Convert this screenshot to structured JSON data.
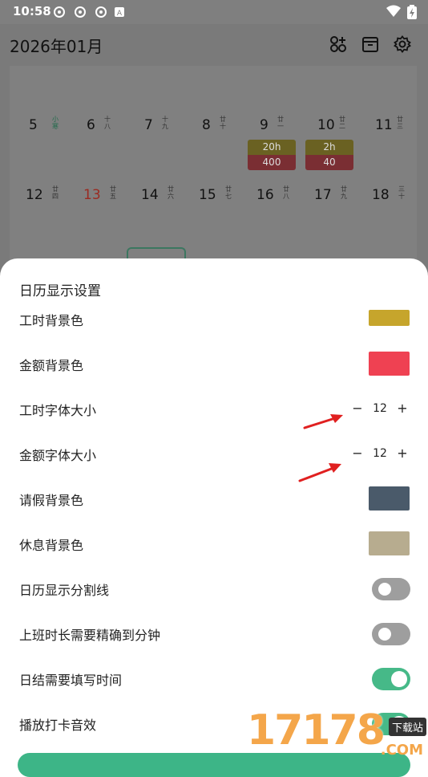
{
  "status_bar": {
    "time": "10:58"
  },
  "header": {
    "title": "2026年01月"
  },
  "calendar": {
    "row1": [
      {
        "day": "5",
        "lunar": "小寒",
        "green": true
      },
      {
        "day": "6",
        "lunar": "十八"
      },
      {
        "day": "7",
        "lunar": "十九"
      },
      {
        "day": "8",
        "lunar": "廿十"
      },
      {
        "day": "9",
        "lunar": "廿一"
      },
      {
        "day": "10",
        "lunar": "廿二"
      },
      {
        "day": "11",
        "lunar": "廿三"
      }
    ],
    "row2": [
      {
        "day": "12",
        "lunar": "廿四"
      },
      {
        "day": "13",
        "lunar": "廿五",
        "red": true
      },
      {
        "day": "14",
        "lunar": "廿六"
      },
      {
        "day": "15",
        "lunar": "廿七"
      },
      {
        "day": "16",
        "lunar": "廿八"
      },
      {
        "day": "17",
        "lunar": "廿九"
      },
      {
        "day": "18",
        "lunar": "三十"
      }
    ],
    "tags": [
      {
        "hours": "20h",
        "amount": "400"
      },
      {
        "hours": "2h",
        "amount": "40"
      }
    ]
  },
  "sheet": {
    "title": "日历显示设置",
    "rows": [
      {
        "label": "工时背景色",
        "type": "color",
        "color": "#c6a52c"
      },
      {
        "label": "金额背景色",
        "type": "color",
        "color": "#ef4152"
      },
      {
        "label": "工时字体大小",
        "type": "stepper",
        "minus": "−",
        "value": "12",
        "plus": "+"
      },
      {
        "label": "金额字体大小",
        "type": "stepper",
        "minus": "−",
        "value": "12",
        "plus": "+"
      },
      {
        "label": "请假背景色",
        "type": "color",
        "color": "#4a5a6a"
      },
      {
        "label": "休息背景色",
        "type": "color",
        "color": "#b7ac8f"
      },
      {
        "label": "日历显示分割线",
        "type": "toggle",
        "on": false
      },
      {
        "label": "上班时长需要精确到分钟",
        "type": "toggle",
        "on": false
      },
      {
        "label": "日结需要填写时间",
        "type": "toggle",
        "on": true
      },
      {
        "label": "播放打卡音效",
        "type": "toggle",
        "on": true
      }
    ]
  },
  "watermark": {
    "big": "17178",
    "badge": "下载站",
    "com": ".COM"
  },
  "colors": {
    "accent": "#3db587",
    "arrow": "#e02020"
  }
}
